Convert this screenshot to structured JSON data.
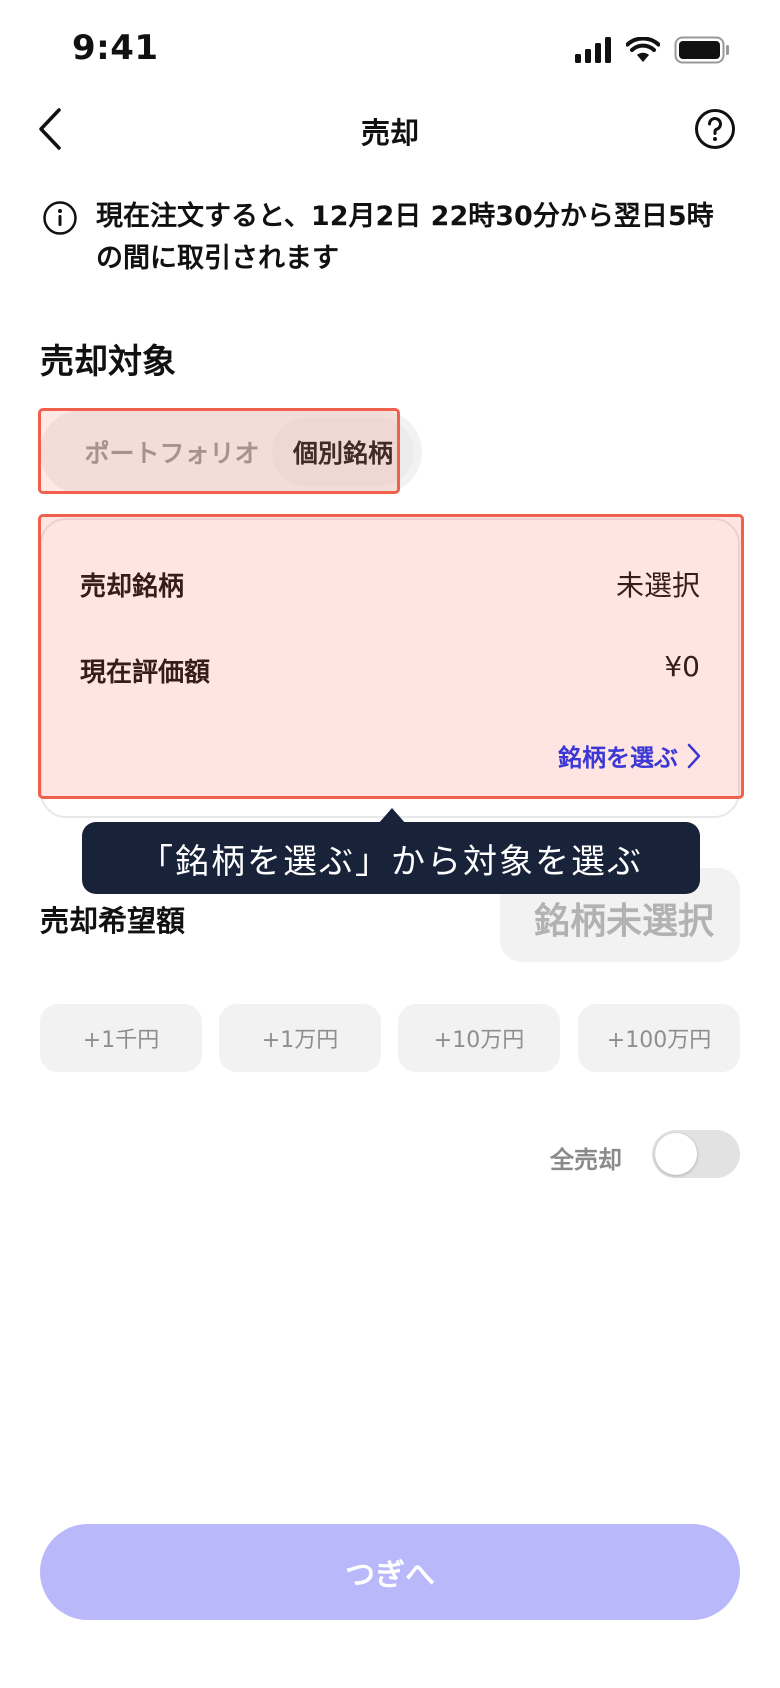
{
  "status_bar": {
    "time": "9:41",
    "icons": [
      "signal-icon",
      "wifi-icon",
      "battery-icon"
    ]
  },
  "header": {
    "title": "売却",
    "back_icon": "chevron-left-icon",
    "help_icon": "question-circle-icon"
  },
  "notice": {
    "icon": "info-icon",
    "text": "現在注文すると、12月2日 22時30分から翌日5時の間に取引されます"
  },
  "section_title": "売却対象",
  "tabs": [
    {
      "label": "ポートフォリオ",
      "selected": false
    },
    {
      "label": "個別銘柄",
      "selected": true
    }
  ],
  "card": {
    "rows": [
      {
        "label": "売却銘柄",
        "value": "未選択"
      },
      {
        "label": "現在評価額",
        "value": "¥0"
      }
    ],
    "link_label": "銘柄を選ぶ"
  },
  "tooltip": "「銘柄を選ぶ」から対象を選ぶ",
  "amount": {
    "label": "売却希望額",
    "value": "銘柄未選択"
  },
  "chips": [
    "+1千円",
    "+1万円",
    "+10万円",
    "+100万円"
  ],
  "sell_all": {
    "label": "全売却",
    "on": false
  },
  "next_button": "つぎへ",
  "colors": {
    "accent": "#3b38d6",
    "button_disabled": "#b9b8fa",
    "highlight": "#f0604a",
    "tooltip_bg": "#18233a"
  }
}
